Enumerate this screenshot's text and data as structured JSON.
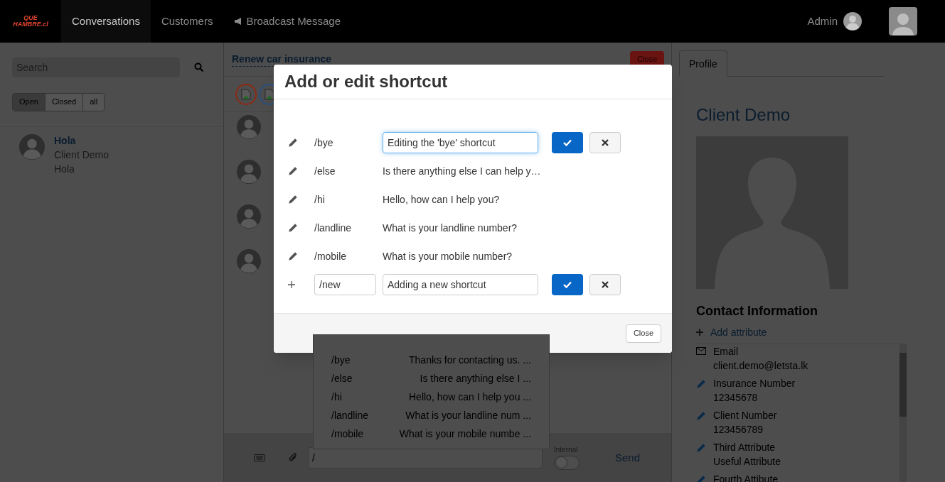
{
  "navbar": {
    "logo": {
      "line_1": "QUE",
      "line_2": "HAMBRE.cl"
    },
    "tabs": [
      {
        "label": "Conversations",
        "selected": true,
        "kind": "text"
      },
      {
        "label": "Customers",
        "selected": false,
        "kind": "text"
      },
      {
        "label": "Broadcast Message",
        "selected": false,
        "kind": "megaphone"
      }
    ],
    "user": "Admin"
  },
  "conversations": {
    "search": {
      "placeholder": "Search"
    },
    "filters": [
      {
        "label": "Open",
        "selected": true
      },
      {
        "label": "Closed",
        "selected": false
      },
      {
        "label": "all",
        "selected": false
      }
    ],
    "items": [
      {
        "title": "Hola",
        "customer": "Client Demo",
        "last_message": "Hola"
      }
    ]
  },
  "chat": {
    "title": "Renew car insurance",
    "close_label": "Close",
    "participants": [
      {
        "color": "#8a2a16"
      },
      {
        "color": "#2a4f80"
      }
    ],
    "suggestions": [
      {
        "shortcut": "/bye",
        "preview": "Thanks for contacting us. ..."
      },
      {
        "shortcut": "/else",
        "preview": "Is there anything else I ..."
      },
      {
        "shortcut": "/hi",
        "preview": "Hello, how can I help you ..."
      },
      {
        "shortcut": "/landline",
        "preview": "What is your landline num ..."
      },
      {
        "shortcut": "/mobile",
        "preview": "What is your mobile numbe ..."
      }
    ],
    "composer": {
      "value": "/",
      "internal_label": "Internal",
      "internal_on": false,
      "send_label": "Send"
    }
  },
  "profile": {
    "tabs": [
      {
        "label": "Profile",
        "selected": true
      }
    ],
    "name": "Client Demo",
    "section_title": "Contact Information",
    "add_label": "Add attribute",
    "attributes": [
      {
        "kind": "email",
        "label": "Email",
        "value": "client.demo@letsta.lk"
      },
      {
        "kind": "custom",
        "label": "Insurance Number",
        "value": "12345678"
      },
      {
        "kind": "custom",
        "label": "Client Number",
        "value": "123456789"
      },
      {
        "kind": "custom",
        "label": "Third Attribute",
        "value": "Useful Attribute"
      },
      {
        "kind": "custom",
        "label": "Fourth Attibute"
      }
    ]
  },
  "dialog": {
    "title": "Add or edit shortcut",
    "rows": [
      {
        "kind": "edit",
        "shortcut": "/bye",
        "value": "Editing the 'bye' shortcut"
      },
      {
        "kind": "view",
        "shortcut": "/else",
        "text": "Is there anything else I can help y…"
      },
      {
        "kind": "view",
        "shortcut": "/hi",
        "text": "Hello, how can I help you?"
      },
      {
        "kind": "view",
        "shortcut": "/landline",
        "text": "What is your landline number?"
      },
      {
        "kind": "view",
        "shortcut": "/mobile",
        "text": "What is your mobile number?"
      },
      {
        "kind": "new",
        "shortcut": "/new",
        "value": "Adding a new shortcut"
      }
    ],
    "close_label": "Close"
  }
}
